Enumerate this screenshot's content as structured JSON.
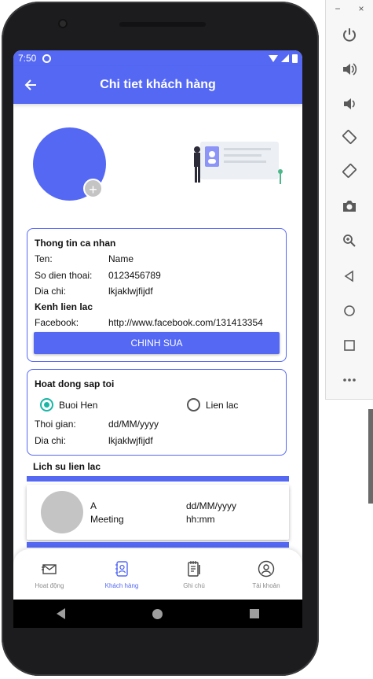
{
  "status_bar": {
    "time": "7:50"
  },
  "app_bar": {
    "title": "Chi tiet khách hàng",
    "back_icon": "arrow-left-icon"
  },
  "personal_card": {
    "heading": "Thong tin ca nhan",
    "rows": [
      {
        "label": "Ten:",
        "value": "Name"
      },
      {
        "label": "So dien thoai:",
        "value": "0123456789"
      },
      {
        "label": "Dia chi:",
        "value": "lkjaklwjfijdf"
      }
    ],
    "contact_heading": "Kenh lien lac",
    "facebook_label": "Facebook:",
    "facebook_value": "http://www.facebook.com/131413354",
    "edit_button": "CHINH SUA"
  },
  "activity_card": {
    "heading": "Hoat dong sap toi",
    "options": [
      {
        "label": "Buoi Hen",
        "checked": true
      },
      {
        "label": "Lien lac",
        "checked": false
      }
    ],
    "time_label": "Thoi gian:",
    "time_value": "dd/MM/yyyy",
    "address_label": "Dia chi:",
    "address_value": "lkjaklwjfijdf"
  },
  "history": {
    "heading": "Lich su lien lac",
    "items": [
      {
        "name": "A",
        "type": "Meeting",
        "date": "dd/MM/yyyy",
        "time": "hh:mm"
      }
    ]
  },
  "bottom_nav": {
    "items": [
      {
        "label": "Hoat động",
        "icon": "mail-icon",
        "active": false
      },
      {
        "label": "Khách hàng",
        "icon": "contacts-book-icon",
        "active": true
      },
      {
        "label": "Ghi chú",
        "icon": "notepad-icon",
        "active": false
      },
      {
        "label": "Tài khoản",
        "icon": "account-circle-icon",
        "active": false
      }
    ]
  },
  "colors": {
    "primary": "#5468f4",
    "radio_checked": "#19b6a6",
    "avatar_grey": "#c4c4c4"
  },
  "emulator_panel": {
    "window_controls": [
      "−",
      "×"
    ],
    "buttons": [
      "power-icon",
      "volume-up-icon",
      "volume-down-icon",
      "rotate-left-icon",
      "rotate-right-icon",
      "camera-icon",
      "zoom-icon",
      "back-icon",
      "home-icon",
      "overview-icon",
      "more-icon"
    ]
  }
}
